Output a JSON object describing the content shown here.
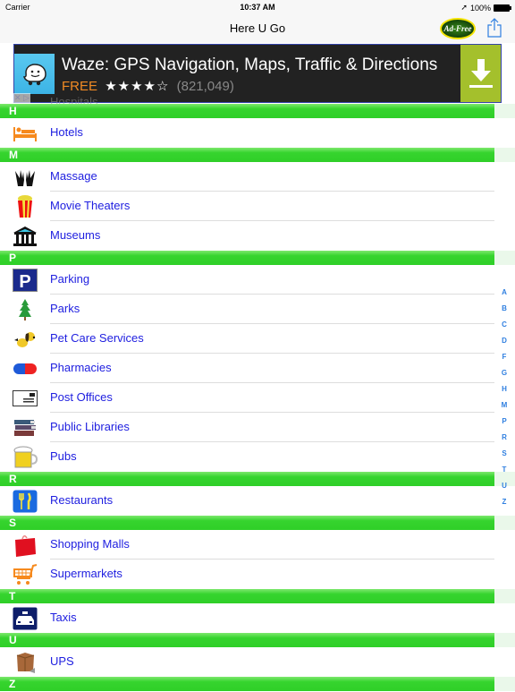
{
  "status_bar": {
    "carrier": "Carrier",
    "time": "10:37 AM",
    "battery": "100%"
  },
  "nav": {
    "title": "Here U Go",
    "adfree_label": "Ad-Free",
    "share_icon": "share-icon"
  },
  "ad": {
    "title": "Waze: GPS Navigation, Maps, Traffic & Directions",
    "price": "FREE",
    "stars": "★★★★☆",
    "rating_value": 4.5,
    "count": "(821,049)",
    "adchoices": "✕ ▷",
    "colors": {
      "background": "#222222",
      "download": "#a4c02c",
      "free": "#f08a24"
    }
  },
  "hidden_row": "Hospitals",
  "sections": [
    {
      "letter": "H",
      "items": [
        {
          "label": "Hotels",
          "icon": "bed-icon"
        }
      ]
    },
    {
      "letter": "M",
      "items": [
        {
          "label": "Massage",
          "icon": "hands-icon"
        },
        {
          "label": "Movie Theaters",
          "icon": "popcorn-icon"
        },
        {
          "label": "Museums",
          "icon": "museum-icon"
        }
      ]
    },
    {
      "letter": "P",
      "items": [
        {
          "label": "Parking",
          "icon": "parking-icon"
        },
        {
          "label": "Parks",
          "icon": "tree-icon"
        },
        {
          "label": "Pet Care Services",
          "icon": "dog-icon"
        },
        {
          "label": "Pharmacies",
          "icon": "pill-icon"
        },
        {
          "label": "Post Offices",
          "icon": "envelope-icon"
        },
        {
          "label": "Public Libraries",
          "icon": "books-icon"
        },
        {
          "label": "Pubs",
          "icon": "beer-icon"
        }
      ]
    },
    {
      "letter": "R",
      "items": [
        {
          "label": "Restaurants",
          "icon": "fork-knife-icon"
        }
      ]
    },
    {
      "letter": "S",
      "items": [
        {
          "label": "Shopping Malls",
          "icon": "shopping-bag-icon"
        },
        {
          "label": "Supermarkets",
          "icon": "cart-icon"
        }
      ]
    },
    {
      "letter": "T",
      "items": [
        {
          "label": "Taxis",
          "icon": "taxi-icon"
        }
      ]
    },
    {
      "letter": "U",
      "items": [
        {
          "label": "UPS",
          "icon": "box-icon"
        }
      ]
    },
    {
      "letter": "Z",
      "items": []
    }
  ],
  "index": [
    "A",
    "B",
    "C",
    "D",
    "F",
    "G",
    "H",
    "M",
    "P",
    "R",
    "S",
    "T",
    "U",
    "Z"
  ],
  "colors": {
    "section": "#2fcf28",
    "link": "#2020e0",
    "index": "#2f7fe0"
  }
}
